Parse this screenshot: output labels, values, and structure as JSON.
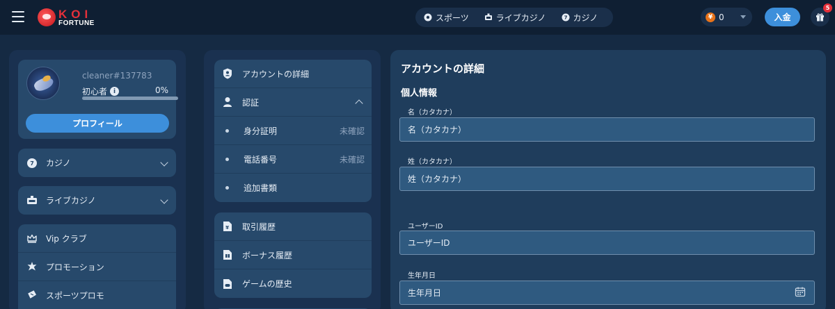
{
  "header": {
    "logo_top": "KOI",
    "logo_bottom": "FORTUNE",
    "nav": [
      {
        "label": "スポーツ",
        "icon": "soccer-ball-icon"
      },
      {
        "label": "ライブカジノ",
        "icon": "live-dealer-icon"
      },
      {
        "label": "カジノ",
        "icon": "casino-chip-icon"
      }
    ],
    "currency_symbol": "¥",
    "balance": "0",
    "deposit_label": "入金",
    "gift_badge": "5"
  },
  "profile": {
    "username": "cleaner#137783",
    "rank": "初心者",
    "progress_text": "0%",
    "progress_value": 0,
    "profile_button": "プロフィール"
  },
  "left_menu": {
    "casino": "カジノ",
    "live_casino": "ライブカジノ",
    "items": [
      "Vip クラブ",
      "プロモーション",
      "スポーツプロモ"
    ]
  },
  "account_menu": {
    "account_details": "アカウントの詳細",
    "verification": "認証",
    "verification_items": [
      {
        "label": "身分証明",
        "status": "未確認"
      },
      {
        "label": "電話番号",
        "status": "未確認"
      },
      {
        "label": "追加書類",
        "status": ""
      }
    ],
    "history_items": [
      "取引履歴",
      "ボーナス履歴",
      "ゲームの歴史"
    ]
  },
  "account_panel": {
    "title": "アカウントの詳細",
    "section": "個人情報",
    "first_name_label": "名（カタカナ）",
    "first_name_placeholder": "名（カタカナ）",
    "last_name_label": "姓（カタカナ）",
    "last_name_placeholder": "姓（カタカナ）",
    "user_id_label": "ユーザーID",
    "user_id_placeholder": "ユーザーID",
    "dob_label": "生年月日",
    "dob_placeholder": "生年月日"
  },
  "colors": {
    "accent": "#3d8fdb",
    "background": "#152a43",
    "card": "#27496b",
    "brand_red": "#e5303a"
  }
}
